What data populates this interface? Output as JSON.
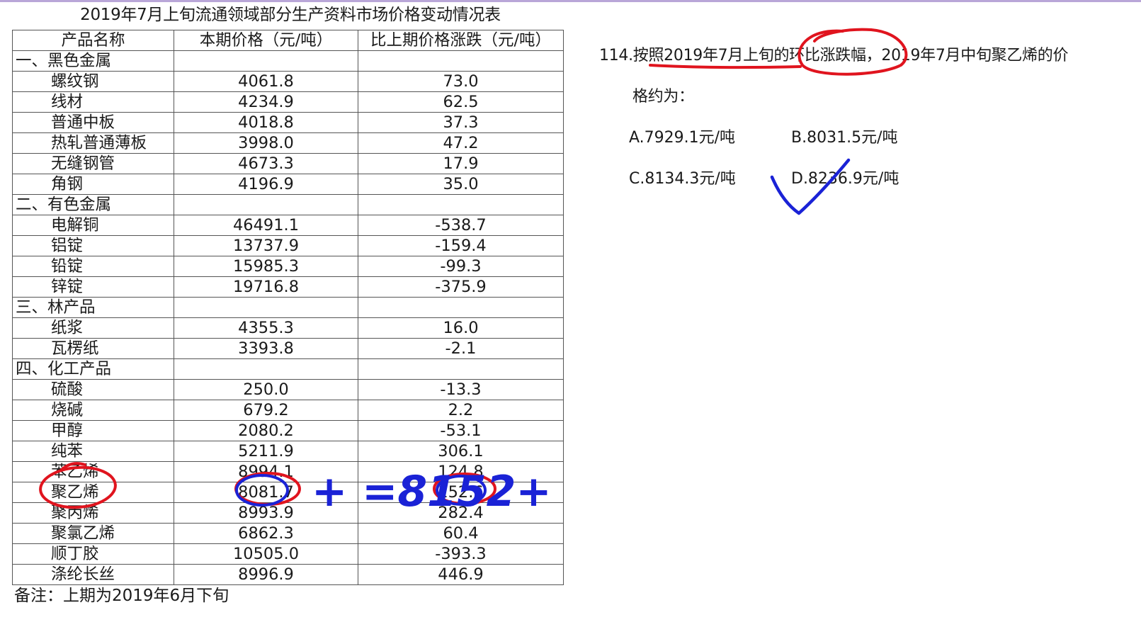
{
  "table": {
    "title": "2019年7月上旬流通领域部分生产资料市场价格变动情况表",
    "headers": [
      "产品名称",
      "本期价格（元/吨）",
      "比上期价格涨跌（元/吨）"
    ],
    "rows": [
      {
        "type": "category",
        "name": "一、黑色金属",
        "price": "",
        "change": ""
      },
      {
        "type": "item",
        "name": "螺纹钢",
        "price": "4061.8",
        "change": "73.0"
      },
      {
        "type": "item",
        "name": "线材",
        "price": "4234.9",
        "change": "62.5"
      },
      {
        "type": "item",
        "name": "普通中板",
        "price": "4018.8",
        "change": "37.3"
      },
      {
        "type": "item",
        "name": "热轧普通薄板",
        "price": "3998.0",
        "change": "47.2"
      },
      {
        "type": "item",
        "name": "无缝钢管",
        "price": "4673.3",
        "change": "17.9"
      },
      {
        "type": "item",
        "name": "角钢",
        "price": "4196.9",
        "change": "35.0"
      },
      {
        "type": "category",
        "name": "二、有色金属",
        "price": "",
        "change": ""
      },
      {
        "type": "item",
        "name": "电解铜",
        "price": "46491.1",
        "change": "-538.7"
      },
      {
        "type": "item",
        "name": "铝锭",
        "price": "13737.9",
        "change": "-159.4"
      },
      {
        "type": "item",
        "name": "铅锭",
        "price": "15985.3",
        "change": "-99.3"
      },
      {
        "type": "item",
        "name": "锌锭",
        "price": "19716.8",
        "change": "-375.9"
      },
      {
        "type": "category",
        "name": "三、林产品",
        "price": "",
        "change": ""
      },
      {
        "type": "item",
        "name": "纸浆",
        "price": "4355.3",
        "change": "16.0"
      },
      {
        "type": "item",
        "name": "瓦楞纸",
        "price": "3393.8",
        "change": "-2.1"
      },
      {
        "type": "category",
        "name": "四、化工产品",
        "price": "",
        "change": ""
      },
      {
        "type": "item",
        "name": "硫酸",
        "price": "250.0",
        "change": "-13.3"
      },
      {
        "type": "item",
        "name": "烧碱",
        "price": "679.2",
        "change": "2.2"
      },
      {
        "type": "item",
        "name": "甲醇",
        "price": "2080.2",
        "change": "-53.1"
      },
      {
        "type": "item",
        "name": "纯苯",
        "price": "5211.9",
        "change": "306.1"
      },
      {
        "type": "item",
        "name": "苯乙烯",
        "price": "8994.1",
        "change": "124.8"
      },
      {
        "type": "item",
        "name": "聚乙烯",
        "price": "8081.7",
        "change": "152.6"
      },
      {
        "type": "item",
        "name": "聚丙烯",
        "price": "8993.9",
        "change": "282.4"
      },
      {
        "type": "item",
        "name": "聚氯乙烯",
        "price": "6862.3",
        "change": "60.4"
      },
      {
        "type": "item",
        "name": "顺丁胶",
        "price": "10505.0",
        "change": "-393.3"
      },
      {
        "type": "item",
        "name": "涤纶长丝",
        "price": "8996.9",
        "change": "446.9"
      }
    ],
    "note": "备注：上期为2019年6月下旬"
  },
  "question": {
    "line1": "114.按照2019年7月上旬的环比涨跌幅，2019年7月中旬聚乙烯的价",
    "line2": "格约为：",
    "options": [
      {
        "label": "A.7929.1元/吨"
      },
      {
        "label": "B.8031.5元/吨"
      },
      {
        "label": "C.8134.3元/吨"
      },
      {
        "label": "D.8236.9元/吨"
      }
    ]
  },
  "annotations": {
    "handwritten": "+ =8152+",
    "ink_red": "#e0141e",
    "ink_blue": "#1a22d6"
  }
}
